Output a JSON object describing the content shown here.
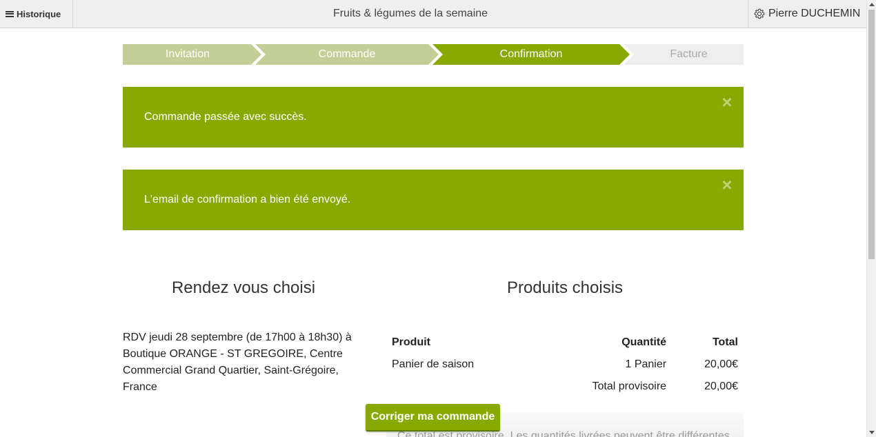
{
  "header": {
    "menu_label": "Historique",
    "title": "Fruits & légumes de la semaine",
    "user_name": "Pierre DUCHEMIN"
  },
  "steps": [
    {
      "label": "Invitation",
      "state": "done"
    },
    {
      "label": "Commande",
      "state": "done"
    },
    {
      "label": "Confirmation",
      "state": "active"
    },
    {
      "label": "Facture",
      "state": "pending"
    }
  ],
  "colors": {
    "accent": "#88aa00",
    "step_done": "#c4cf98",
    "step_active": "#88aa00",
    "step_pending": "#eeeeee",
    "step_pending_text": "#aaaaaa"
  },
  "alerts": [
    {
      "message": "Commande passée avec succès.",
      "close_icon": "×"
    },
    {
      "message": "L'email de confirmation a bien été envoyé.",
      "close_icon": "×"
    }
  ],
  "appointment": {
    "heading": "Rendez vous choisi",
    "text": "RDV jeudi 28 septembre (de 17h00 à 18h30) à Boutique ORANGE - ST GREGOIRE, Centre Commercial Grand Quartier, Saint-Grégoire, France"
  },
  "products": {
    "heading": "Produits choisis",
    "columns": [
      "Produit",
      "Quantité",
      "Total"
    ],
    "rows": [
      {
        "product": "Panier de saison",
        "quantity": "1 Panier",
        "total": "20,00€"
      }
    ],
    "subtotal_label": "Total provisoire",
    "subtotal_value": "20,00€",
    "note": "Ce total est provisoire. Les quantités livrées peuvent être différentes"
  },
  "actions": {
    "correct_order_label": "Corriger ma commande"
  }
}
